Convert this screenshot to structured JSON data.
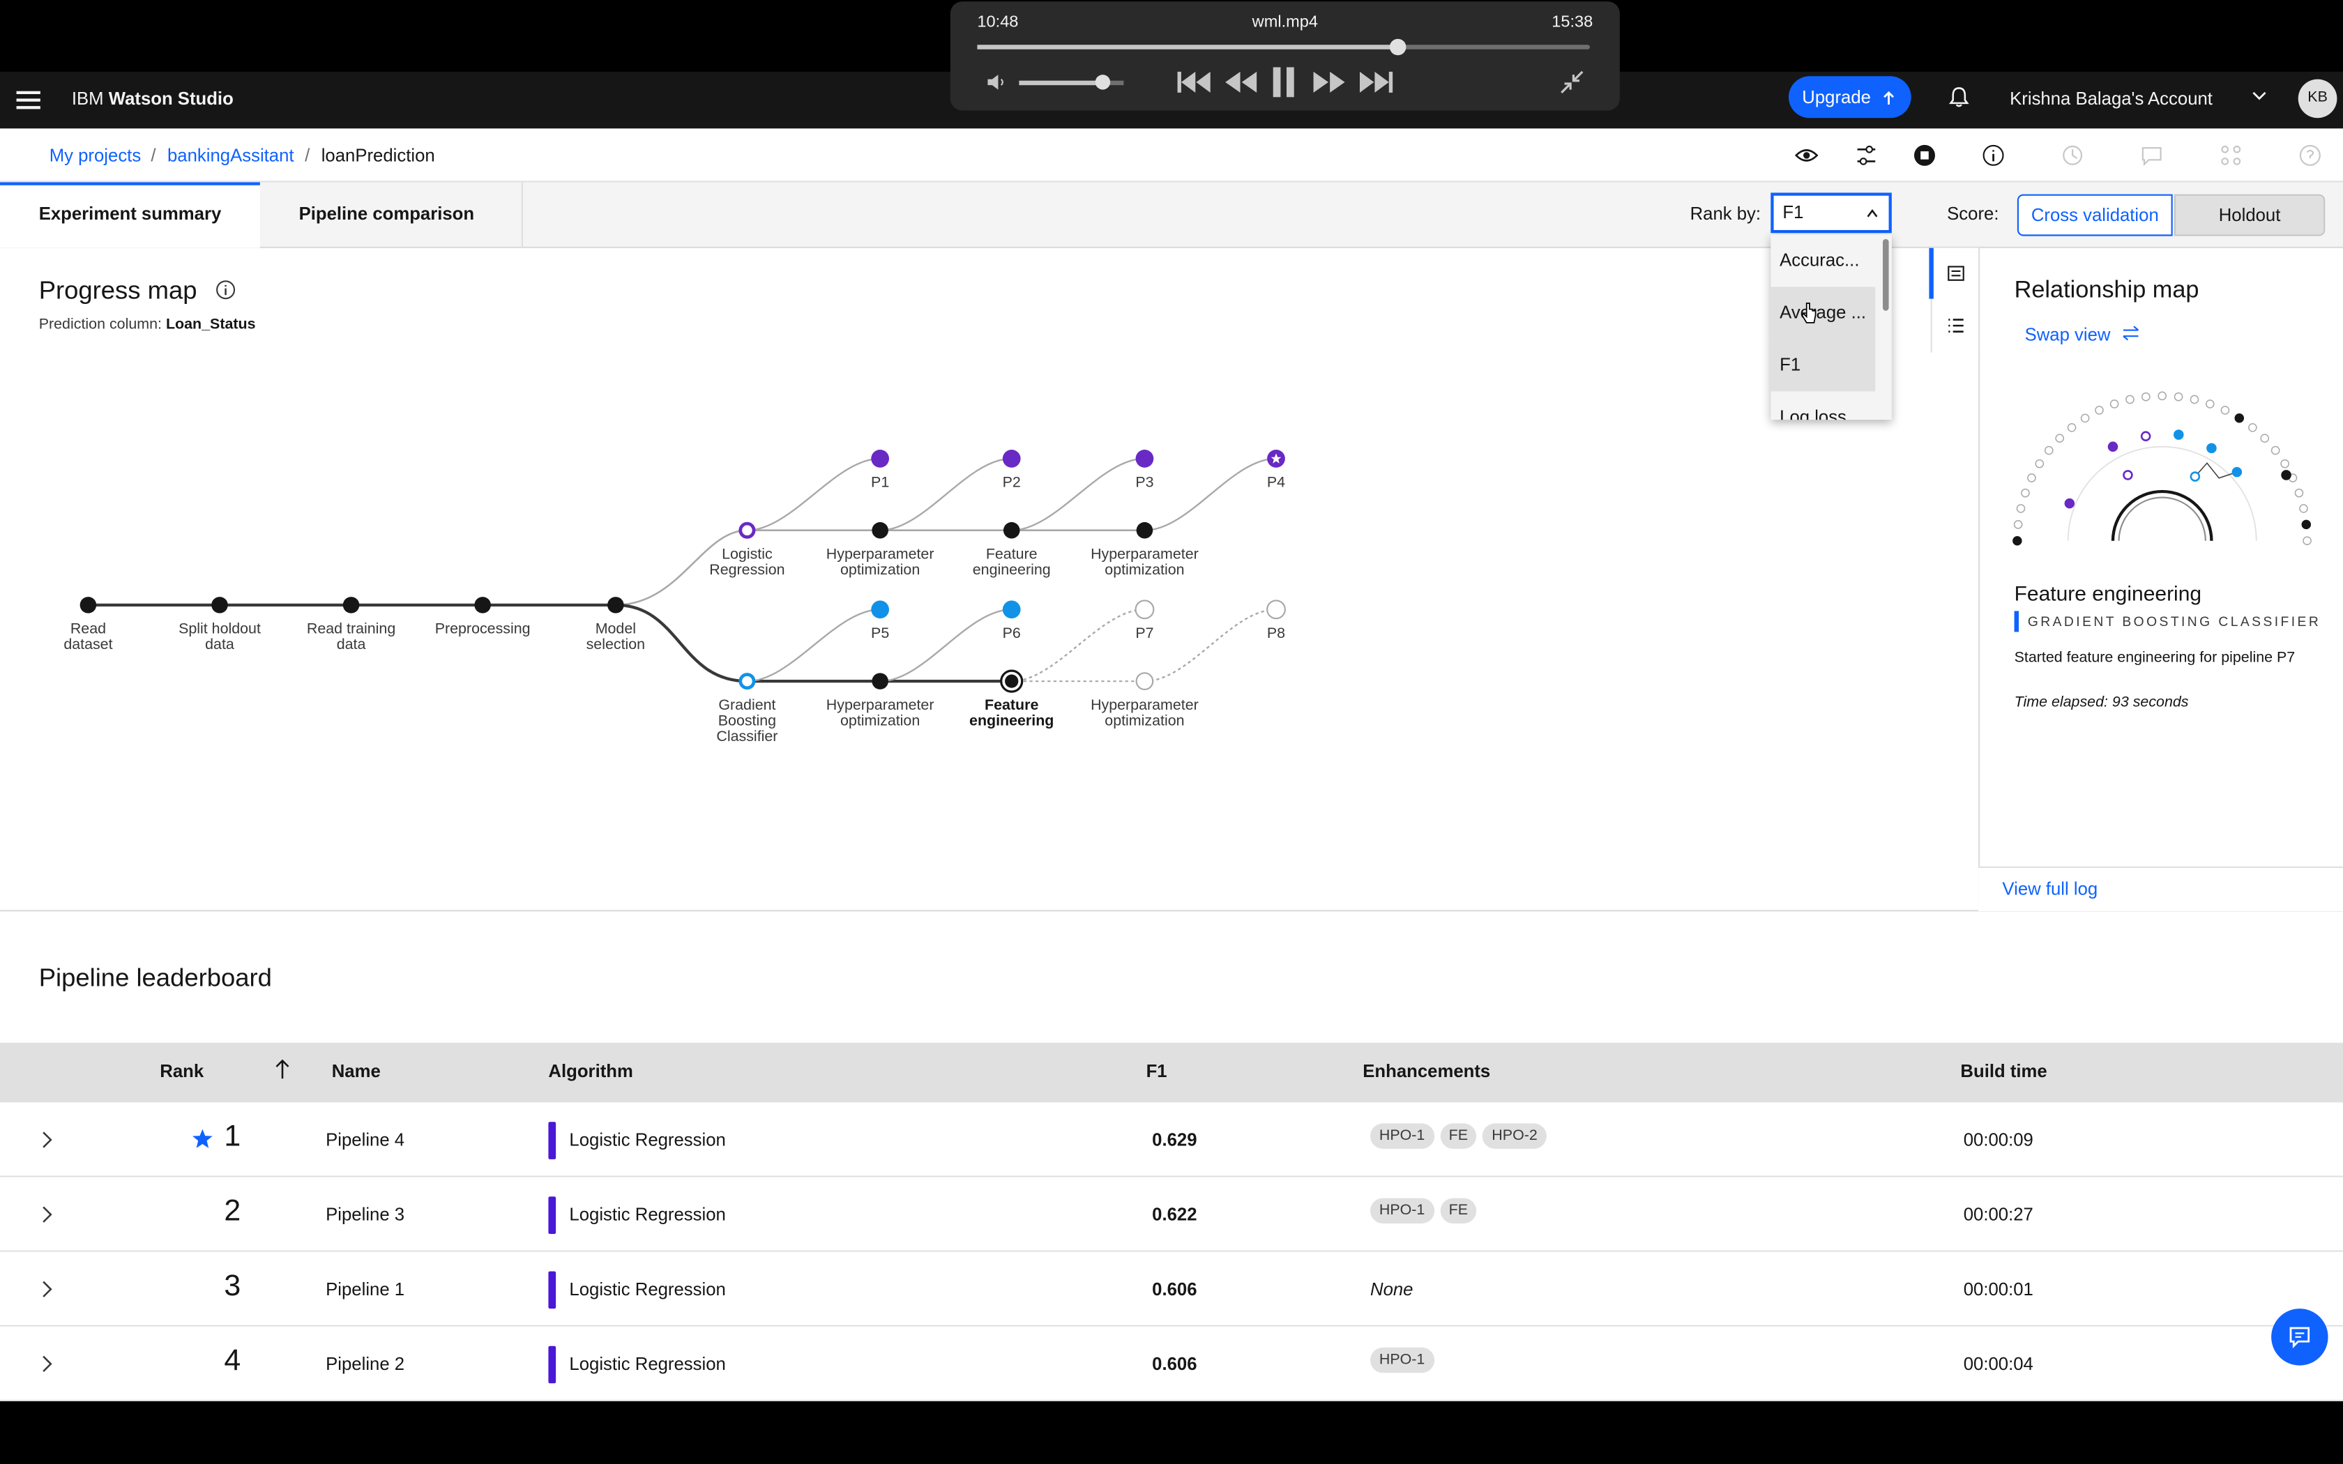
{
  "video_player": {
    "elapsed": "10:48",
    "file": "wml.mp4",
    "duration": "15:38",
    "progress_fraction": 0.69,
    "volume_fraction": 0.8
  },
  "header": {
    "brand_prefix": "IBM",
    "brand_name": "Watson Studio",
    "upgrade_label": "Upgrade",
    "account_name": "Krishna Balaga's Account",
    "avatar_initials": "KB"
  },
  "breadcrumb": {
    "items": [
      "My projects",
      "bankingAssitant",
      "loanPrediction"
    ],
    "separator": "/"
  },
  "tabs": [
    "Experiment summary",
    "Pipeline comparison"
  ],
  "toolbar": {
    "rank_by_label": "Rank by:",
    "rank_by_value": "F1",
    "score_label": "Score:",
    "score_options": [
      "Cross validation",
      "Holdout"
    ],
    "selected_score": "Cross validation"
  },
  "rank_dropdown": {
    "options": [
      "Accurac...",
      "Average ...",
      "F1",
      "Log loss"
    ],
    "hovered": "Average ..."
  },
  "progress_map": {
    "title": "Progress map",
    "prediction_label": "Prediction column:",
    "prediction_value": "Loan_Status",
    "main_steps": [
      "Read dataset",
      "Split holdout data",
      "Read training data",
      "Preprocessing",
      "Model selection"
    ],
    "branch_top": {
      "algorithm": "Logistic Regression",
      "steps": [
        "Hyperparameter optimization",
        "Feature engineering",
        "Hyperparameter optimization"
      ],
      "pipelines": [
        "P1",
        "P2",
        "P3",
        "P4"
      ]
    },
    "branch_bottom": {
      "algorithm": "Gradient Boosting Classifier",
      "steps": [
        "Hyperparameter optimization",
        "Feature engineering",
        "Hyperparameter optimization"
      ],
      "pipelines": [
        "P5",
        "P6",
        "P7",
        "P8"
      ]
    },
    "colors": {
      "lr": "#6929c4",
      "gbc": "#1192e8",
      "done": "#161616",
      "pending": "#a8a8a8"
    }
  },
  "relationship_map": {
    "title": "Relationship map",
    "swap_view_label": "Swap view",
    "current_step": "Feature engineering",
    "current_algorithm": "GRADIENT BOOSTING CLASSIFIER",
    "status_text": "Started feature engineering for pipeline P7",
    "elapsed_text": "Time elapsed: 93 seconds",
    "view_full_log_label": "View full log"
  },
  "leaderboard": {
    "title": "Pipeline leaderboard",
    "columns": [
      "Rank",
      "Name",
      "Algorithm",
      "F1",
      "Enhancements",
      "Build time"
    ],
    "rows": [
      {
        "rank": "1",
        "name": "Pipeline 4",
        "algorithm": "Logistic Regression",
        "score": "0.629",
        "enhancements": [
          "HPO-1",
          "FE",
          "HPO-2"
        ],
        "build_time": "00:00:09",
        "starred": true
      },
      {
        "rank": "2",
        "name": "Pipeline 3",
        "algorithm": "Logistic Regression",
        "score": "0.622",
        "enhancements": [
          "HPO-1",
          "FE"
        ],
        "build_time": "00:00:27",
        "starred": false
      },
      {
        "rank": "3",
        "name": "Pipeline 1",
        "algorithm": "Logistic Regression",
        "score": "0.606",
        "enhancements": [],
        "none_label": "None",
        "build_time": "00:00:01",
        "starred": false
      },
      {
        "rank": "4",
        "name": "Pipeline 2",
        "algorithm": "Logistic Regression",
        "score": "0.606",
        "enhancements": [
          "HPO-1"
        ],
        "build_time": "00:00:04",
        "starred": false
      }
    ]
  }
}
